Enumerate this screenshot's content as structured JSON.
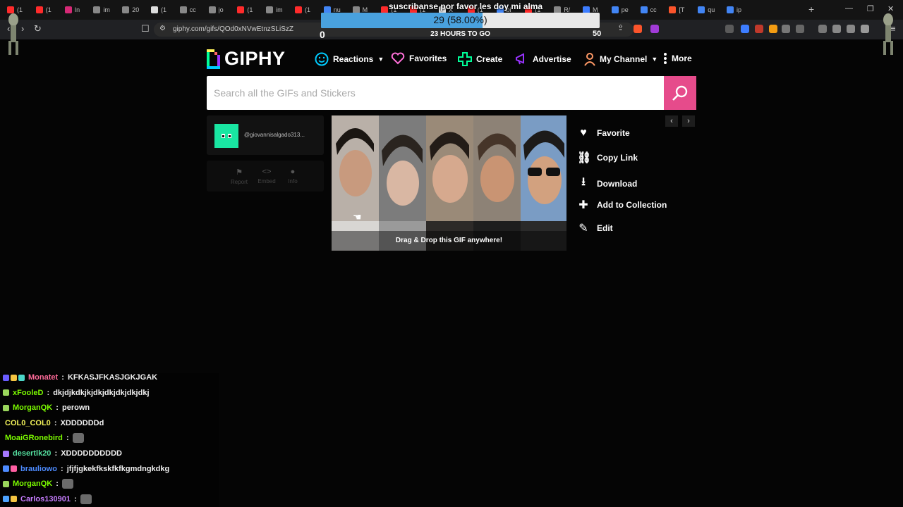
{
  "browser": {
    "tabs": [
      "(1",
      "(1",
      "In",
      "im",
      "20",
      "(1",
      "cc",
      "jo",
      "(1",
      "im",
      "(1",
      "nu",
      "M",
      "(1",
      "(1",
      "X",
      "(1",
      "bi",
      "(1",
      "R/",
      "M",
      "pe",
      "cc",
      "[T",
      "qu",
      "ip"
    ],
    "url": "giphy.com/gifs/QOd0xNVwEtnzSLiSzZ"
  },
  "goal": {
    "title": "suscribanse por favor les doy mi alma",
    "value_text": "29 (58.00%)",
    "progress_fraction": 0.58,
    "min_label": "0",
    "time_left": "23 HOURS TO GO",
    "max_label": "50"
  },
  "giphy": {
    "logo_text": "GIPHY",
    "nav": [
      {
        "label": "Reactions",
        "icon": "smiley-icon",
        "has_caret": true
      },
      {
        "label": "Favorites",
        "icon": "heart-icon",
        "has_caret": false
      },
      {
        "label": "Create",
        "icon": "plus-icon",
        "has_caret": false
      },
      {
        "label": "Advertise",
        "icon": "megaphone-icon",
        "has_caret": false
      },
      {
        "label": "My Channel",
        "icon": "user-icon",
        "has_caret": true
      },
      {
        "label": "More",
        "icon": "kebab-icon",
        "has_caret": false
      }
    ],
    "search_placeholder": "Search all the GIFs and Stickers",
    "user_handle": "@giovannisalgado313...",
    "mini_actions": [
      "Report",
      "Embed",
      "Info"
    ],
    "gif_caption": "Drag & Drop this GIF anywhere!",
    "side_actions": [
      "Favorite",
      "Copy Link",
      "Download",
      "Add to Collection",
      "Edit"
    ]
  },
  "chat": [
    {
      "user": "Monatet",
      "color": "#ff6b9a",
      "message": "KFKASJFKASJGKJGAK",
      "badges": [
        "#6a5cff",
        "#f5c542",
        "#4cd6c8"
      ]
    },
    {
      "user": "xFooleD",
      "color": "#7cfc00",
      "message": "dkjdjkdkjkjdkjdkjdkjdkjdkj",
      "badges": [
        "#9ad65c"
      ]
    },
    {
      "user": "MorganQK",
      "color": "#7cfc00",
      "message": "perown",
      "badges": [
        "#9ad65c"
      ]
    },
    {
      "user": "COL0_COL0",
      "color": "#f3f35a",
      "message": "XDDDDDDd",
      "badges": []
    },
    {
      "user": "MoaiGRonebird",
      "color": "#7cfc00",
      "message": "",
      "badges": [],
      "emote": true
    },
    {
      "user": "desertlk20",
      "color": "#55e0a0",
      "message": "XDDDDDDDDDD",
      "badges": [
        "#a678ff"
      ]
    },
    {
      "user": "brauliowo",
      "color": "#4d8bff",
      "message": "jfjfjgkekfkskfkfkgmdngkdkg",
      "badges": [
        "#4d8bff",
        "#ff5fa2"
      ]
    },
    {
      "user": "MorganQK",
      "color": "#7cfc00",
      "message": "",
      "badges": [
        "#9ad65c"
      ],
      "emote": true
    },
    {
      "user": "Carlos130901",
      "color": "#c77dff",
      "message": "",
      "badges": [
        "#4da3ff",
        "#f5c542"
      ],
      "emote": true
    }
  ]
}
